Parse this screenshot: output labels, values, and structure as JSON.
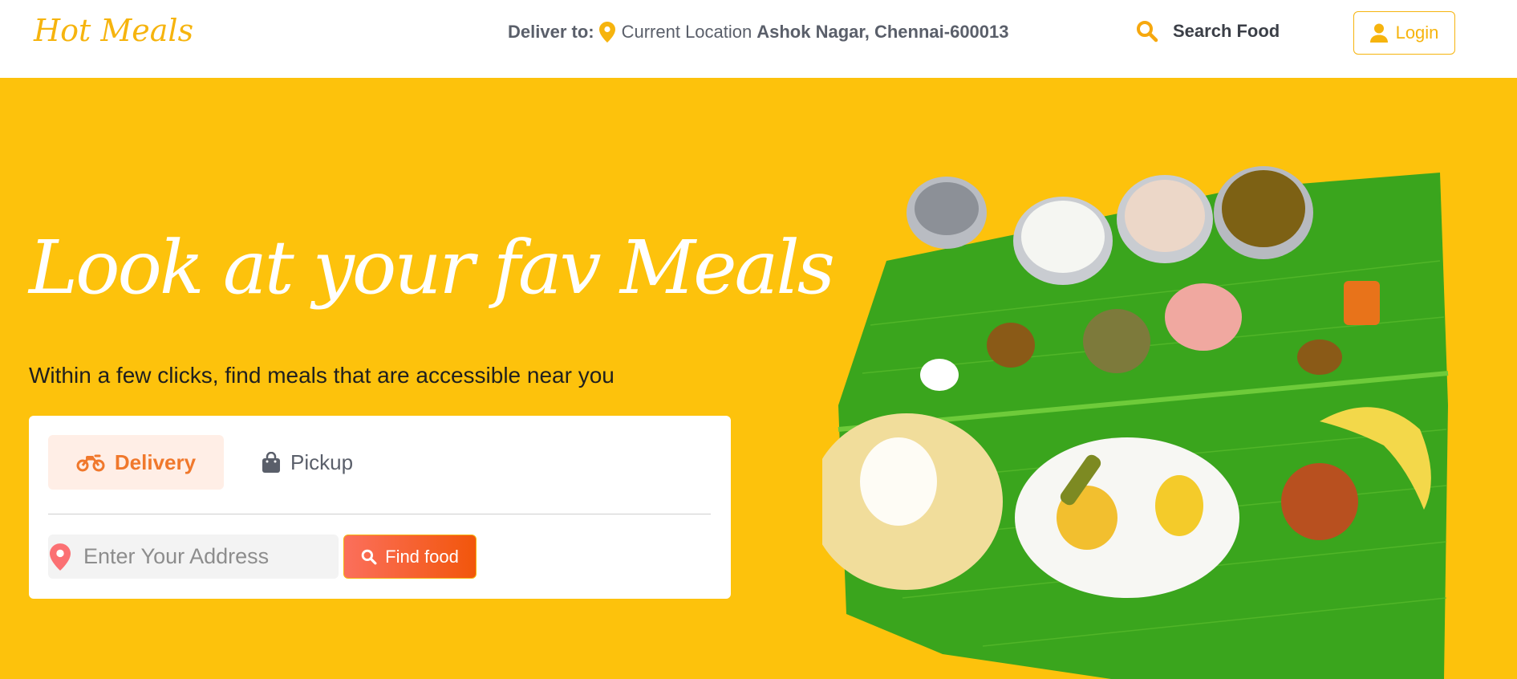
{
  "header": {
    "logo": "Hot Meals",
    "deliver_label": "Deliver to:",
    "location_label": "Current Location",
    "location_address": "Ashok Nagar, Chennai-600013",
    "search_label": "Search Food",
    "login_label": "Login"
  },
  "hero": {
    "title": "Look at your fav Meals",
    "subtitle": "Within a few clicks, find meals that are accessible near you"
  },
  "order_card": {
    "tabs": [
      {
        "label": "Delivery",
        "icon": "motorbike-icon",
        "active": true
      },
      {
        "label": "Pickup",
        "icon": "shopping-bag-icon",
        "active": false
      }
    ],
    "address_placeholder": "Enter Your Address",
    "find_button": "Find food"
  },
  "colors": {
    "brand_yellow": "#fdc20c",
    "accent_orange": "#f0782c",
    "button_gradient_start": "#fb6f5c",
    "button_gradient_end": "#f2560b"
  }
}
